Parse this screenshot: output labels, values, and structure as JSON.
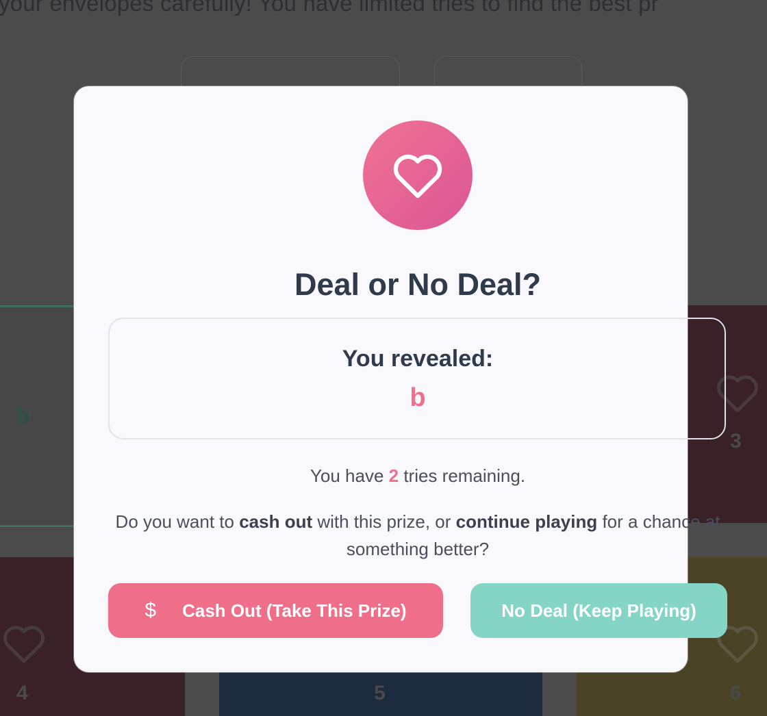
{
  "background": {
    "top_text": "your envelopes carefully! You have limited tries to find the best pr",
    "cards": [
      {
        "letter": "b",
        "number": ""
      },
      {
        "letter": "",
        "number": "3"
      },
      {
        "letter": "",
        "number": "4"
      },
      {
        "letter": "",
        "number": "5"
      },
      {
        "letter": "",
        "number": "6"
      }
    ],
    "colors": {
      "card_maroon": "#3a2128",
      "card_navy": "#1c2b3d",
      "card_olive": "#4a4326",
      "card_grey": "#474747"
    }
  },
  "modal": {
    "icon": "heart-icon",
    "title": "Deal or No Deal?",
    "reveal_label": "You revealed:",
    "reveal_value": "b",
    "tries_prefix": "You have ",
    "tries_count": "2",
    "tries_suffix": " tries remaining.",
    "question_parts": {
      "p1": "Do you want to ",
      "b1": "cash out",
      "p2": " with this prize, or ",
      "b2": "continue playing",
      "p3": " for a chance at something better?"
    },
    "cash_out_icon": "dollar-icon",
    "cash_out_label": "Cash Out (Take This Prize)",
    "no_deal_label": "No Deal (Keep Playing)",
    "colors": {
      "accent_pink": "#ef6f8a",
      "accent_teal": "#84d5c6",
      "title": "#2f3a4a"
    }
  }
}
